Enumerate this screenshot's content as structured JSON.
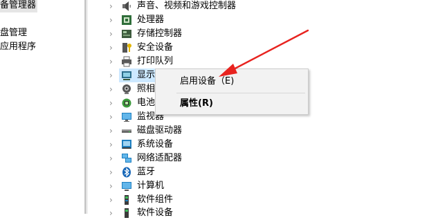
{
  "left_pane": {
    "items": [
      {
        "label": "备管理器",
        "selected": true
      },
      {
        "label": "盘管理"
      },
      {
        "label": "应用程序"
      }
    ]
  },
  "tree": {
    "items": [
      {
        "label": "声音、视频和游戏控制器",
        "icon": "speaker-icon"
      },
      {
        "label": "处理器",
        "icon": "processor-icon"
      },
      {
        "label": "存储控制器",
        "icon": "storage-controller-icon"
      },
      {
        "label": "安全设备",
        "icon": "security-device-icon"
      },
      {
        "label": "打印队列",
        "icon": "printer-icon"
      },
      {
        "label": "显示适配器",
        "icon": "display-adapter-icon",
        "highlighted": true
      },
      {
        "label": "照相机",
        "icon": "camera-icon"
      },
      {
        "label": "电池",
        "icon": "battery-icon"
      },
      {
        "label": "监视器",
        "icon": "monitor-icon"
      },
      {
        "label": "磁盘驱动器",
        "icon": "disk-drive-icon"
      },
      {
        "label": "系统设备",
        "icon": "system-device-icon"
      },
      {
        "label": "网络适配器",
        "icon": "network-adapter-icon"
      },
      {
        "label": "蓝牙",
        "icon": "bluetooth-icon"
      },
      {
        "label": "计算机",
        "icon": "computer-icon"
      },
      {
        "label": "软件组件",
        "icon": "software-component-icon"
      },
      {
        "label": "软件设备",
        "icon": "software-device-icon"
      }
    ]
  },
  "context_menu": {
    "enable_label": "启用设备（E)",
    "properties_label": "属性(R)"
  },
  "annotation": {
    "arrow_color": "#e8231f"
  },
  "colors": {
    "selection": "#cce8ff",
    "menu_bg": "#f2f2f2"
  }
}
